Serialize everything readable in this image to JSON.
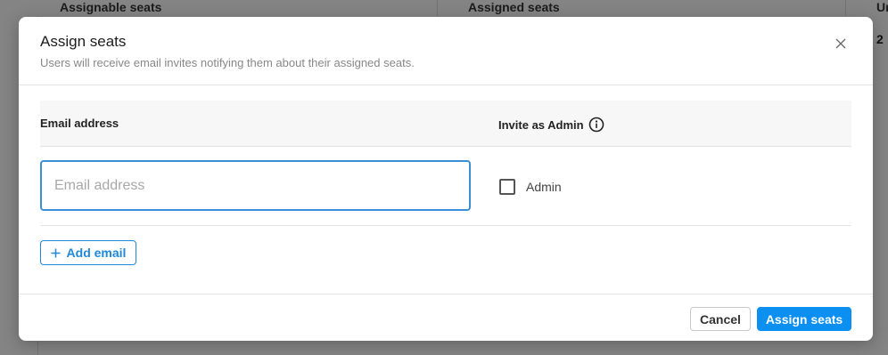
{
  "background": {
    "columns": [
      "Assignable seats",
      "Assigned seats",
      "Ur"
    ],
    "partial_value": "2"
  },
  "modal": {
    "title": "Assign seats",
    "subtitle": "Users will receive email invites notifying them about their assigned seats.",
    "table": {
      "email_header": "Email address",
      "admin_header": "Invite as Admin"
    },
    "row": {
      "email_value": "",
      "email_placeholder": "Email address",
      "admin_label": "Admin",
      "admin_checked": false
    },
    "add_email_label": "Add email",
    "cancel_label": "Cancel",
    "assign_label": "Assign seats"
  },
  "colors": {
    "accent": "#0b8ff0",
    "focus_border": "#3a8fd6"
  },
  "icons": {
    "close": "close-icon",
    "info": "info-icon",
    "plus": "plus-icon"
  }
}
